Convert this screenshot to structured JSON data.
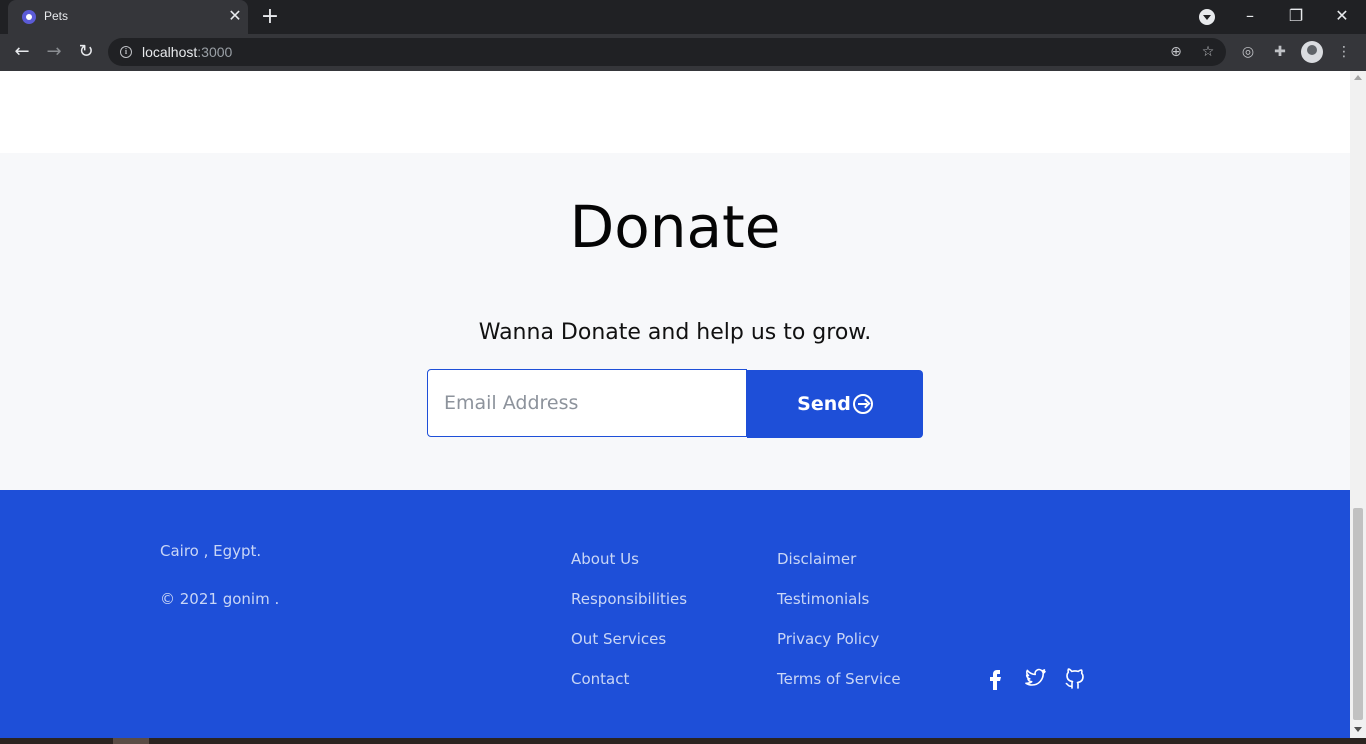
{
  "browser": {
    "tab_title": "Pets",
    "url_host": "localhost",
    "url_port": ":3000"
  },
  "donate": {
    "title": "Donate",
    "subtitle": "Wanna Donate and help us to grow.",
    "email_placeholder": "Email Address",
    "send_label": "Send"
  },
  "footer": {
    "location": "Cairo , Egypt.",
    "copyright": "© 2021 gonim .",
    "links_col1": [
      "About Us",
      "Responsibilities",
      "Out Services",
      "Contact"
    ],
    "links_col2": [
      "Disclaimer",
      "Testimonials",
      "Privacy Policy",
      "Terms of Service"
    ],
    "social_icons": [
      "facebook-icon",
      "twitter-icon",
      "github-icon"
    ]
  },
  "colors": {
    "accent": "#1e4fd8",
    "section_bg": "#f7f8fa",
    "footer_text": "#c9d6f6"
  }
}
